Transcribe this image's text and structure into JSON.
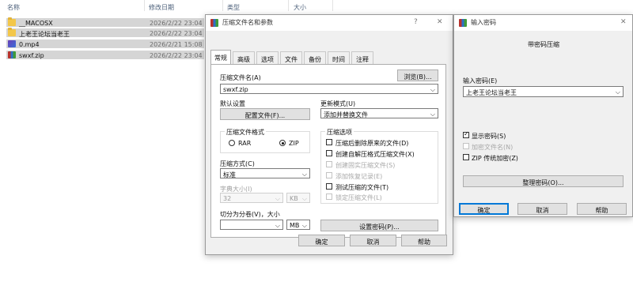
{
  "explorer": {
    "columns": {
      "name": "名称",
      "date": "修改日期",
      "type": "类型",
      "size": "大小"
    },
    "files": [
      {
        "name": "__MACOSX",
        "date": "2026/2/22 23:04",
        "icon": "folder-icon"
      },
      {
        "name": "上老王论坛当老王",
        "date": "2026/2/22 23:04",
        "icon": "folder-icon"
      },
      {
        "name": "0.mp4",
        "date": "2026/2/21 15:08",
        "icon": "video-file-icon"
      },
      {
        "name": "swxf.zip",
        "date": "2026/2/22 23:04",
        "icon": "winrar-archive-icon"
      }
    ]
  },
  "archive_dialog": {
    "title": "压缩文件名和参数",
    "help_glyph": "?",
    "close_glyph": "✕",
    "tabs": [
      "常规",
      "高级",
      "选项",
      "文件",
      "备份",
      "时间",
      "注释"
    ],
    "archive_name_label": "压缩文件名(A)",
    "browse_button": "浏览(B)...",
    "archive_name_value": "swxf.zip",
    "default_settings_label": "默认设置",
    "profiles_button": "配置文件(F)...",
    "update_mode_label": "更新模式(U)",
    "update_mode_value": "添加并替换文件",
    "format_group": "压缩文件格式",
    "format_rar": "RAR",
    "format_zip": "ZIP",
    "method_label": "压缩方式(C)",
    "method_value": "标准",
    "dict_label": "字典大小(I)",
    "dict_value": "32",
    "dict_unit": "KB",
    "split_label": "切分为分卷(V)，大小",
    "split_unit": "MB",
    "options_group": "压缩选项",
    "options": [
      {
        "label": "压缩后删除原来的文件(D)",
        "checked": false,
        "enabled": true
      },
      {
        "label": "创建自解压格式压缩文件(X)",
        "checked": false,
        "enabled": true
      },
      {
        "label": "创建固实压缩文件(S)",
        "checked": false,
        "enabled": false
      },
      {
        "label": "添加恢复记录(E)",
        "checked": false,
        "enabled": false
      },
      {
        "label": "测试压缩的文件(T)",
        "checked": false,
        "enabled": true
      },
      {
        "label": "锁定压缩文件(L)",
        "checked": false,
        "enabled": false
      }
    ],
    "set_password_button": "设置密码(P)...",
    "ok_button": "确定",
    "cancel_button": "取消",
    "help_button": "帮助"
  },
  "password_dialog": {
    "title": "输入密码",
    "close_glyph": "✕",
    "subtitle": "带密码压缩",
    "password_label": "输入密码(E)",
    "password_value": "上老王论坛当老王",
    "show_password": "显示密码(S)",
    "encrypt_names": "加密文件名(N)",
    "zip_legacy": "ZIP 传统加密(Z)",
    "organize_button": "整理密码(O)...",
    "ok_button": "确定",
    "cancel_button": "取消",
    "help_button": "帮助"
  }
}
